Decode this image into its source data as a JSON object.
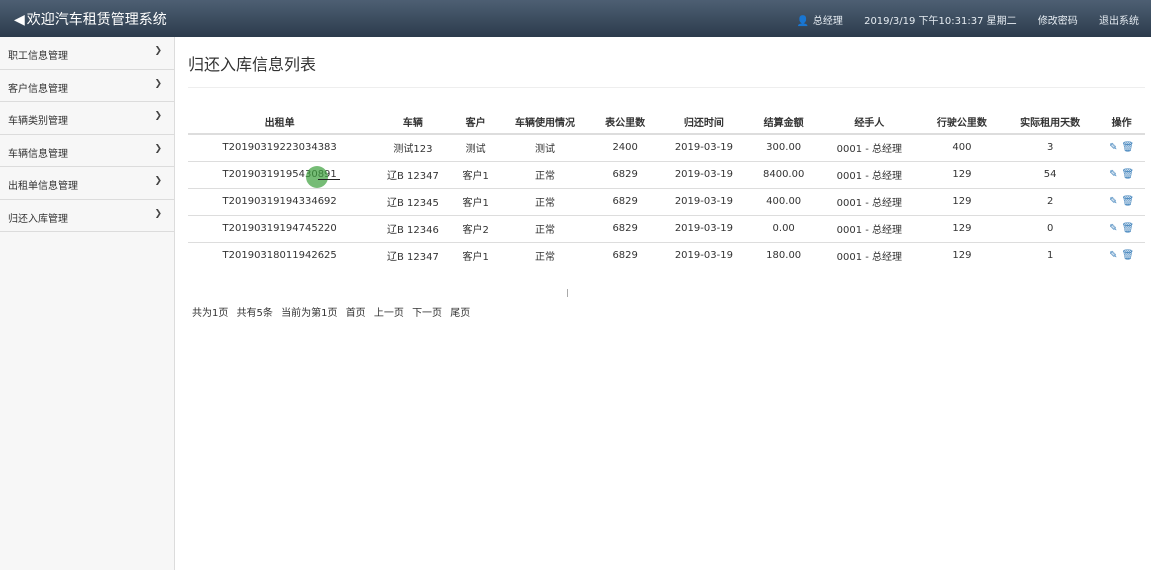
{
  "header": {
    "title": "欢迎汽车租赁管理系统",
    "user": "总经理",
    "datetime": "2019/3/19 下午10:31:37 星期二",
    "change_password": "修改密码",
    "logout": "退出系统"
  },
  "sidebar": {
    "items": [
      {
        "label": "职工信息管理"
      },
      {
        "label": "客户信息管理"
      },
      {
        "label": "车辆类别管理"
      },
      {
        "label": "车辆信息管理"
      },
      {
        "label": "出租单信息管理"
      },
      {
        "label": "归还入库管理"
      }
    ]
  },
  "main": {
    "title": "归还入库信息列表",
    "columns": [
      "出租单",
      "车辆",
      "客户",
      "车辆使用情况",
      "表公里数",
      "归还时间",
      "结算金额",
      "经手人",
      "行驶公里数",
      "实际租用天数",
      "操作"
    ],
    "rows": [
      [
        "T20190319223034383",
        "测试123",
        "测试",
        "测试",
        "2400",
        "2019-03-19",
        "300.00",
        "0001 - 总经理",
        "400",
        "3"
      ],
      [
        "T20190319195430891",
        "辽B 12347",
        "客户1",
        "正常",
        "6829",
        "2019-03-19",
        "8400.00",
        "0001 - 总经理",
        "129",
        "54"
      ],
      [
        "T20190319194334692",
        "辽B 12345",
        "客户1",
        "正常",
        "6829",
        "2019-03-19",
        "400.00",
        "0001 - 总经理",
        "129",
        "2"
      ],
      [
        "T20190319194745220",
        "辽B 12346",
        "客户2",
        "正常",
        "6829",
        "2019-03-19",
        "0.00",
        "0001 - 总经理",
        "129",
        "0"
      ],
      [
        "T20190318011942625",
        "辽B 12347",
        "客户1",
        "正常",
        "6829",
        "2019-03-19",
        "180.00",
        "0001 - 总经理",
        "129",
        "1"
      ]
    ],
    "pager": {
      "total_pages": "共为1页",
      "total_records": "共有5条",
      "current": "当前为第1页",
      "first": "首页",
      "prev": "上一页",
      "next": "下一页",
      "last": "尾页"
    }
  },
  "icons": {
    "edit": "pencil-icon",
    "delete": "trash-icon",
    "user": "user-icon",
    "menu": "chevron-down-icon"
  },
  "colors": {
    "header_bg": "#34465a",
    "link": "#337ab7"
  }
}
